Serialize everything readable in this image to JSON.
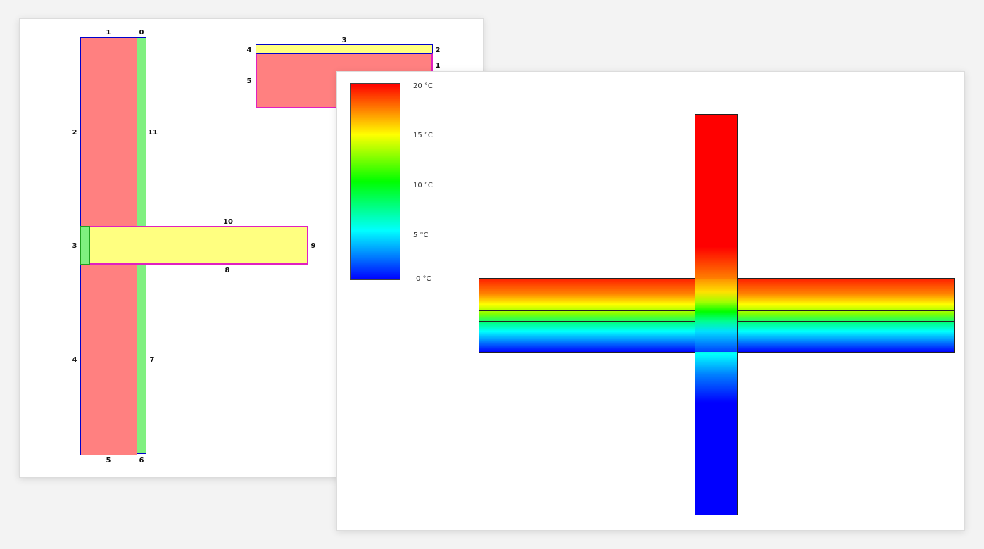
{
  "back_diagram": {
    "edge_labels": {
      "wall_top_left": "1",
      "wall_top_right": "0",
      "wall_left_upper": "2",
      "wall_left_mid": "3",
      "wall_left_lower": "4",
      "wall_bottom_left": "5",
      "wall_bottom_right": "6",
      "wall_right_lower": "7",
      "slab_bottom": "8",
      "slab_end": "9",
      "slab_top": "10",
      "wall_right_upper": "11",
      "detail_top": "3",
      "detail_left_upper": "4",
      "detail_left_lower": "5",
      "detail_right_upper": "2",
      "detail_right_lower": "1"
    },
    "colors": {
      "masonry": "#ff8080",
      "insulation": "#80f080",
      "slab": "#ffff80",
      "outline_blue": "#0000cc",
      "outline_magenta": "#e020c0"
    }
  },
  "front_diagram": {
    "scale_labels": [
      "20 °C",
      "15 °C",
      "10 °C",
      "5 °C",
      "0 °C"
    ],
    "scale_range_celsius": [
      0,
      20
    ],
    "colormap": "rainbow red-to-blue"
  }
}
